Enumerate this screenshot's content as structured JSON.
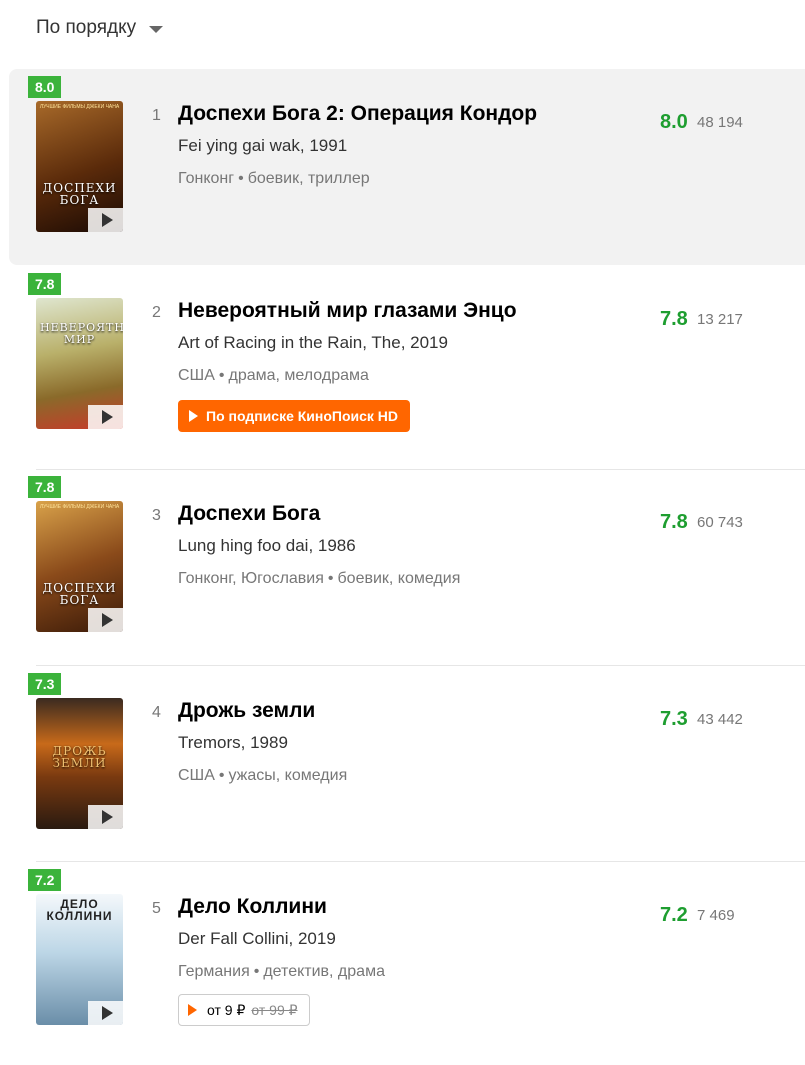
{
  "sort": {
    "label": "По порядку"
  },
  "films": [
    {
      "position": "1",
      "title": "Доспехи Бога 2: Операция Кондор",
      "original": "Fei ying gai wak, 1991",
      "country": "Гонконг",
      "genres": "боевик, триллер",
      "rating": "8.0",
      "votes": "48 194",
      "poster_text": "ДОСПЕХИ БОГА",
      "poster_top": "ЛУЧШИЕ ФИЛЬМЫ ДЖЕКИ ЧАНА",
      "poster_color": "#6a3a14"
    },
    {
      "position": "2",
      "title": "Невероятный мир глазами Энцо",
      "original": "Art of Racing in the Rain, The, 2019",
      "country": "США",
      "genres": "драма, мелодрама",
      "rating": "7.8",
      "votes": "13 217",
      "poster_text": "НЕВЕРОЯТНЫЙ МИР",
      "button": "По подписке КиноПоиск HD",
      "poster_color": "#8a8a3a"
    },
    {
      "position": "3",
      "title": "Доспехи Бога",
      "original": "Lung hing foo dai, 1986",
      "country": "Гонконг, Югославия",
      "genres": "боевик, комедия",
      "rating": "7.8",
      "votes": "60 743",
      "poster_text": "ДОСПЕХИ БОГА",
      "poster_top": "ЛУЧШИЕ ФИЛЬМЫ ДЖЕКИ ЧАНА",
      "poster_color": "#7a3a10"
    },
    {
      "position": "4",
      "title": "Дрожь земли",
      "original": "Tremors, 1989",
      "country": "США",
      "genres": "ужасы, комедия",
      "rating": "7.3",
      "votes": "43 442",
      "poster_text": "ДРОЖЬ ЗЕМЛИ",
      "poster_color": "#5a2a0a"
    },
    {
      "position": "5",
      "title": "Дело Коллини",
      "original": "Der Fall Collini, 2019",
      "country": "Германия",
      "genres": "детектив, драма",
      "rating": "7.2",
      "votes": "7 469",
      "poster_text": "ДЕЛО КОЛЛИНИ",
      "price": "от 9 ₽",
      "price_old": "от 99 ₽",
      "poster_color": "#cfe3ee"
    }
  ],
  "colors": {
    "rating_green": "#1e9e30",
    "badge_green": "#3bb33b",
    "accent_orange": "#ff6600",
    "row_highlight": "#f2f2f2"
  }
}
